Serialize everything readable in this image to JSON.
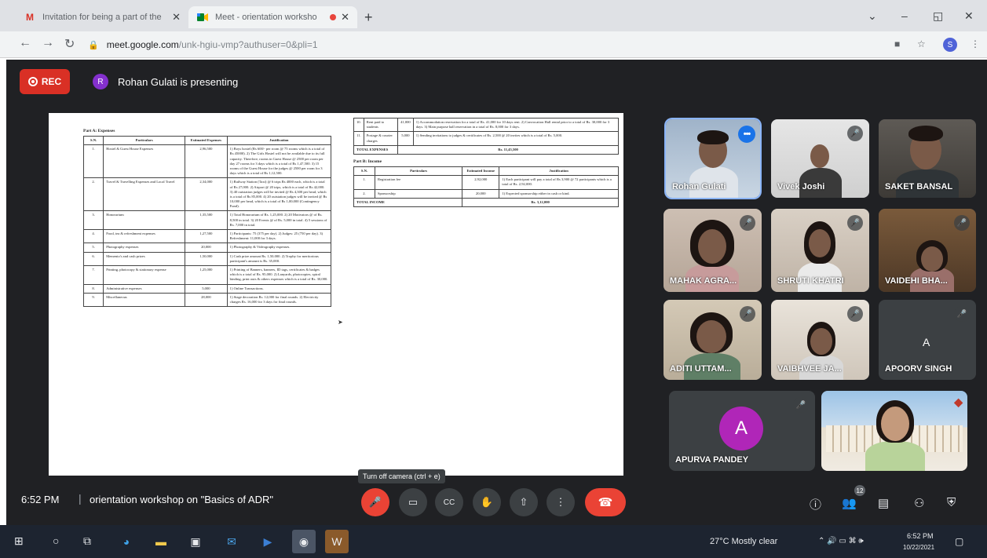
{
  "browser": {
    "tabs": [
      {
        "title": "Invitation for being a part of the",
        "icon": "gmail-icon"
      },
      {
        "title": "Meet - orientation worksho",
        "icon": "meet-icon",
        "recording": true
      }
    ],
    "new_tab": "+",
    "window_controls": {
      "tab_search": "⌄",
      "minimize": "–",
      "restore": "◱",
      "close": "✕"
    },
    "url_host": "meet.google.com",
    "url_path": "/unk-hgiu-vmp?authuser=0&pli=1",
    "profile_initial": "S"
  },
  "meet": {
    "rec_label": "REC",
    "presenter": {
      "initial": "R",
      "text": "Rohan Gulati is presenting"
    },
    "document": {
      "part_a_title": "Part A: Expenses",
      "part_a_headers": [
        "S.N.",
        "Particulars",
        "Estimated Expenses",
        "Justification"
      ],
      "part_a_rows": [
        [
          "1.",
          "Hostel & Guest House Expenses",
          "2,96,500",
          "1) Boys hostel (Rs 600/- per room @ 75 rooms which is a total of Rs 45000). 2) The Girls Hostel will not be available due to its full capacity. Therefore, rooms in Guest House @ 2500 per room per day 27 rooms for 3 days which is a total of Rs 1,47,500. 3) 15 rooms of the Guest House for the judges @ 2500 per room for 3 days which is a total of Rs 1,12,500."
        ],
        [
          "2.",
          "Travel & Travelling Expenses and Local Travel",
          "2,34,000",
          "1) Railway Station (Taxi) @ 6 trips Rs 4000 each, which is a total of Rs 27,000. 2) Airport @ 20 trips, which is a total of Rs 42,000. 3) 40 outstation judges will be invited @ Rs 4,300 per head, which is a total of Rs 85,000. 4) 20 outstation judges will be invited @ Rs 10,000 per head, which is a total of Rs 1,00,000 (Contingency Fund)."
        ],
        [
          "3.",
          "Honorarium",
          "1,35,500",
          "1) Total Honorarium of Rs. 1,25,000. 2) 20 Motivators @ of Rs. 8,500 in total. 3) 20 Events @ of Rs. 5,000 in total. 4) 5 sessions of Rs. 7,000 in total."
        ],
        [
          "4.",
          "Food, tea & refreshment expenses",
          "1,27,500",
          "1) Participants: 75 (375 per day). 2) Judges: 25 (750 per day). 3) Refreshment: 11,000 for 3 days."
        ],
        [
          "5.",
          "Photography expenses",
          "20,000",
          "1) Photography & Videography expenses."
        ],
        [
          "6.",
          "Memento's and cash prizes",
          "1,50,000",
          "1) Cash prize amount Rs. 1,50,000. 2) Trophy for meritorious participant's amount is Rs. 35,000."
        ],
        [
          "7.",
          "Printing, photocopy & stationary expense",
          "1,25,000",
          "1) Printing of Banners, banners, ID tags, certificates & badges which is a total of Rs. 95,000. 2) Lanyards, photocopies, spiral binding, print outs & others expenses which is a total of Rs. 30,000."
        ],
        [
          "8.",
          "Administrative expenses",
          "5,000",
          "1) Online Transactions."
        ],
        [
          "9.",
          "Miscellaneous",
          "28,000",
          "1) Stage decoration Rs. 12,000 for final rounds. 2) Electricity charges Rs. 16,000 for 3 days for final rounds."
        ]
      ],
      "part_a_cont_rows": [
        [
          "10.",
          "Rent paid to students",
          "41,000",
          "1) Accommodation reservation for a total of Rs. 41,000 for 10 days rent. 2) Convocation Hall rental prior to a total of Rs. 30,000 for 3 days. 3) Main purpose hall reservation in a total of Rs. 8,000 for 3 days."
        ],
        [
          "11.",
          "Postage & courier charges",
          "5,000",
          "1) Sending invitations to judges & certificates of Rs. 2,500 @ 20 invites which is a total of Rs. 5,000."
        ]
      ],
      "total_expenses_label": "TOTAL EXPENSES",
      "total_expenses_value": "Rs. 11,45,500",
      "part_b_title": "Part B: Income",
      "part_b_headers": [
        "S.N.",
        "Particulars",
        "Estimated Income",
        "Justification"
      ],
      "part_b_rows": [
        [
          "1.",
          "Registration fee",
          "2,92,000",
          "1) Each participant will pay a total of Rs 3,900 @ 72 participants which is a total of Rs. 2,92,000."
        ],
        [
          "2.",
          "Sponsorship",
          "20,000",
          "1) Expected sponsorship either in cash or kind."
        ]
      ],
      "total_income_label": "TOTAL INCOME",
      "total_income_value": "Rs. 3,12,000"
    },
    "participants": [
      {
        "name": "Rohan Gulati",
        "badge": "•••"
      },
      {
        "name": "Vivek Joshi",
        "badge": "🎤"
      },
      {
        "name": "SAKET BANSAL",
        "badge": ""
      },
      {
        "name": "MAHAK AGRA...",
        "badge": "🎤"
      },
      {
        "name": "SHRUTI KHATRI",
        "badge": "🎤"
      },
      {
        "name": "VAIDEHI BHA...",
        "badge": "🎤"
      },
      {
        "name": "ADITI UTTAM...",
        "badge": "🎤"
      },
      {
        "name": "VAIBHVEE JA...",
        "badge": "🎤"
      },
      {
        "name": "APOORV SINGH",
        "badge": "🎤",
        "initial": "A"
      },
      {
        "name": "APURVA PANDEY",
        "badge": "🎤",
        "initial": "A"
      },
      {
        "name": "",
        "badge": ""
      }
    ],
    "controls": {
      "time": "6:52 PM",
      "separator": "|",
      "meeting_title": "orientation workshop on \"Basics of ADR\"",
      "tooltip": "Turn off camera (ctrl + e)",
      "mic": "🎤",
      "camera": "▭",
      "captions": "CC",
      "hand": "✋",
      "present": "⇧",
      "more": "⋮",
      "end_call": "☎",
      "info": "ⓘ",
      "people": "👥",
      "chat": "▤",
      "activities": "⚇",
      "host_controls": "⛨",
      "people_count": "12"
    }
  },
  "taskbar": {
    "start": "⊞",
    "search": "○",
    "task_view": "⧉",
    "apps": [
      "edge-icon",
      "file-explorer-icon",
      "store-icon",
      "mail-icon",
      "media-player-icon",
      "chrome-icon",
      "word-icon"
    ],
    "weather": "27°C  Mostly clear",
    "tray": "⌃  🔊  ▭  ⌘  🕪",
    "clock_time": "6:52 PM",
    "clock_date": "10/22/2021",
    "notifications": "▢"
  }
}
